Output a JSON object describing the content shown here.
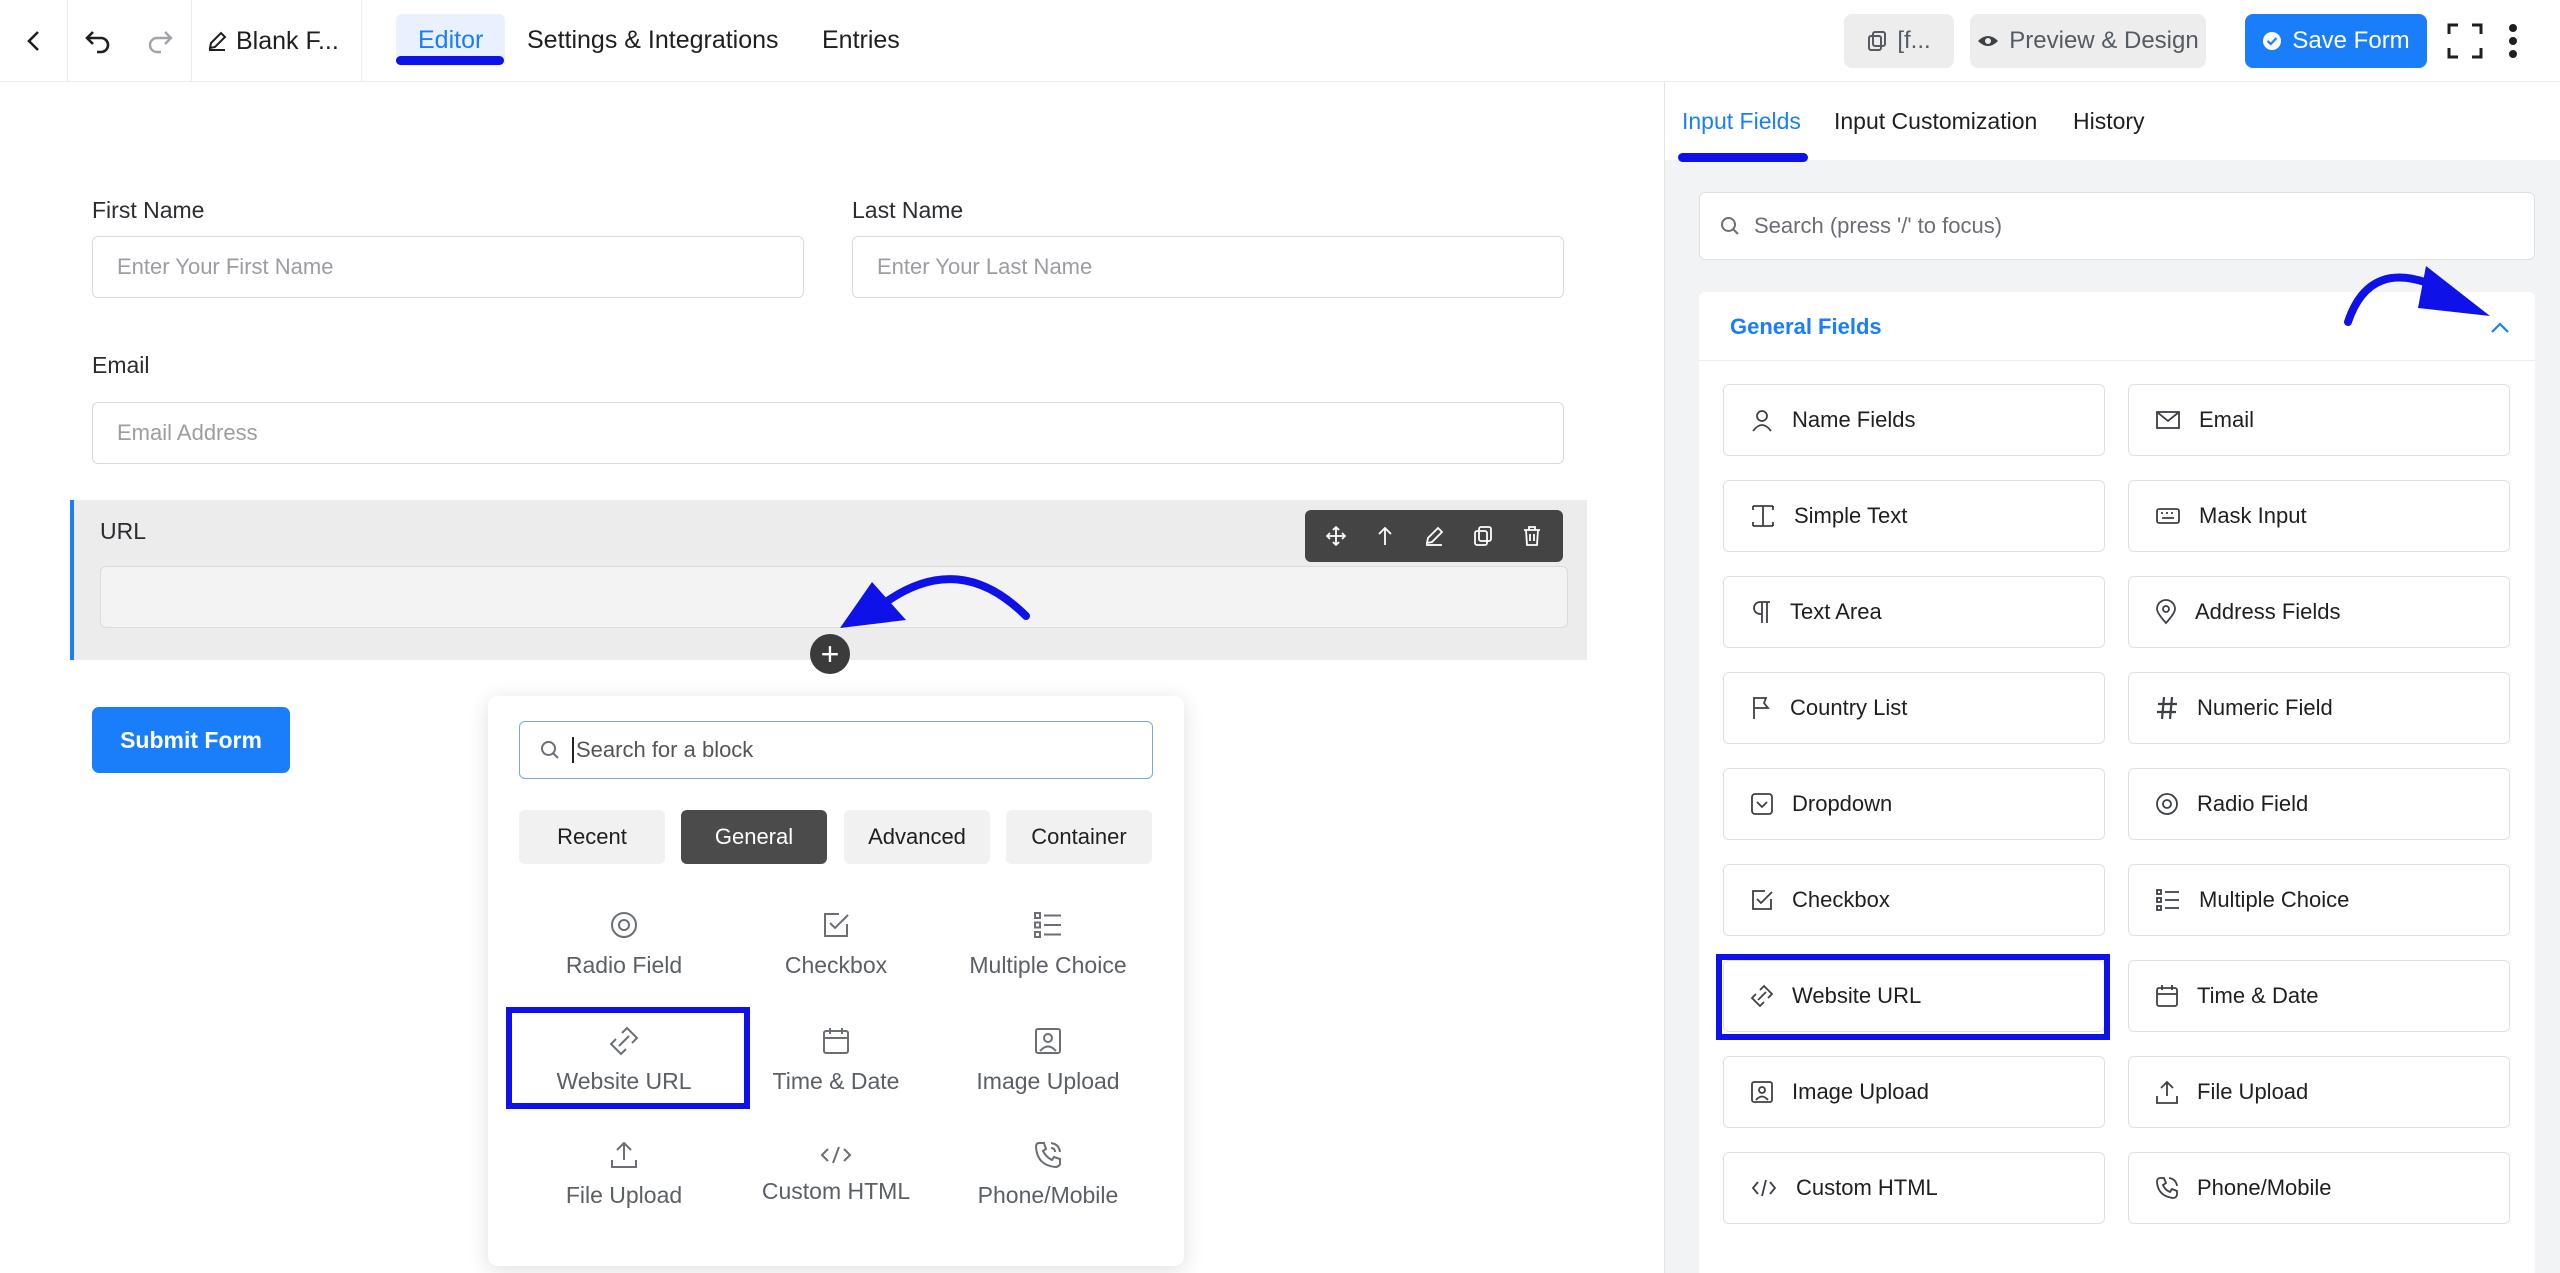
{
  "topbar": {
    "form_title": "Blank F...",
    "tabs": [
      "Editor",
      "Settings & Integrations",
      "Entries"
    ],
    "shortcode_label": "[f...",
    "preview_label": "Preview & Design",
    "save_label": "Save Form"
  },
  "form": {
    "first_name": {
      "label": "First Name",
      "placeholder": "Enter Your First Name"
    },
    "last_name": {
      "label": "Last Name",
      "placeholder": "Enter Your Last Name"
    },
    "email": {
      "label": "Email",
      "placeholder": "Email Address"
    },
    "url": {
      "label": "URL"
    },
    "submit_label": "Submit Form",
    "add_symbol": "+"
  },
  "picker": {
    "search_placeholder": "Search for a block",
    "tabs": [
      "Recent",
      "General",
      "Advanced",
      "Container"
    ],
    "active_tab": "General",
    "items": [
      {
        "label": "Radio Field",
        "icon": "radio-icon"
      },
      {
        "label": "Checkbox",
        "icon": "checkbox-icon"
      },
      {
        "label": "Multiple Choice",
        "icon": "list-icon"
      },
      {
        "label": "Website URL",
        "icon": "link-icon"
      },
      {
        "label": "Time & Date",
        "icon": "calendar-icon"
      },
      {
        "label": "Image Upload",
        "icon": "image-icon"
      },
      {
        "label": "File Upload",
        "icon": "upload-icon"
      },
      {
        "label": "Custom HTML",
        "icon": "code-icon"
      },
      {
        "label": "Phone/Mobile",
        "icon": "phone-icon"
      }
    ]
  },
  "sidebar": {
    "tabs": [
      "Input Fields",
      "Input Customization",
      "History"
    ],
    "search_placeholder": "Search (press '/' to focus)",
    "section_title": "General Fields",
    "fields": [
      {
        "label": "Name Fields",
        "icon": "user-icon"
      },
      {
        "label": "Email",
        "icon": "envelope-icon"
      },
      {
        "label": "Simple Text",
        "icon": "text-cursor-icon"
      },
      {
        "label": "Mask Input",
        "icon": "keyboard-icon"
      },
      {
        "label": "Text Area",
        "icon": "paragraph-icon"
      },
      {
        "label": "Address Fields",
        "icon": "map-pin-icon"
      },
      {
        "label": "Country List",
        "icon": "flag-icon"
      },
      {
        "label": "Numeric Field",
        "icon": "hash-icon"
      },
      {
        "label": "Dropdown",
        "icon": "dropdown-icon"
      },
      {
        "label": "Radio Field",
        "icon": "radio-icon"
      },
      {
        "label": "Checkbox",
        "icon": "checkbox-icon"
      },
      {
        "label": "Multiple Choice",
        "icon": "list-icon"
      },
      {
        "label": "Website URL",
        "icon": "link-icon"
      },
      {
        "label": "Time & Date",
        "icon": "calendar-icon"
      },
      {
        "label": "Image Upload",
        "icon": "image-icon"
      },
      {
        "label": "File Upload",
        "icon": "upload-icon"
      },
      {
        "label": "Custom HTML",
        "icon": "code-icon"
      },
      {
        "label": "Phone/Mobile",
        "icon": "phone-icon"
      }
    ]
  },
  "colors": {
    "accent": "#1a7efb",
    "annotation": "#0f12e8"
  }
}
